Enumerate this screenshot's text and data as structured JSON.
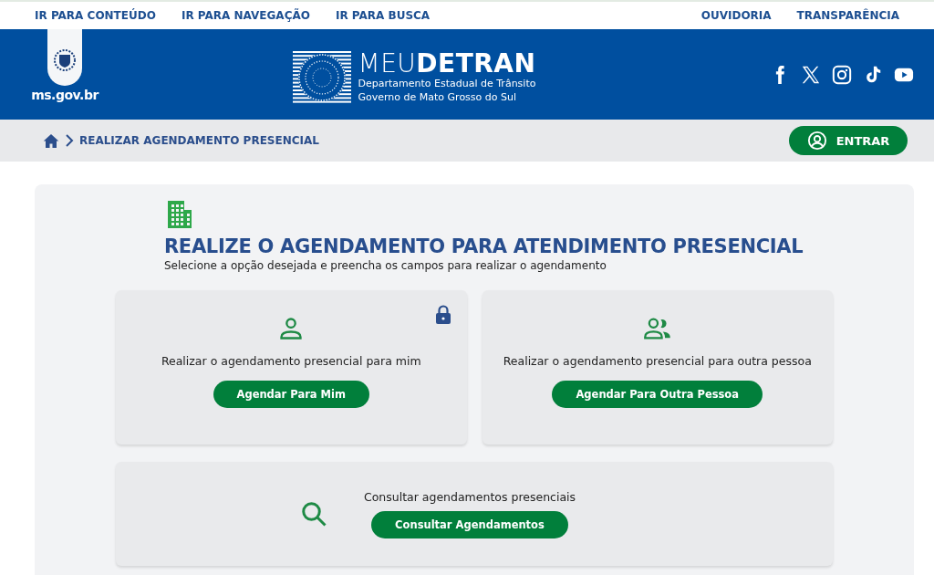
{
  "skip_links": [
    {
      "label": "IR PARA CONTEÚDO"
    },
    {
      "label": "IR PARA NAVEGAÇÃO"
    },
    {
      "label": "IR PARA BUSCA"
    }
  ],
  "top_links": [
    {
      "label": "OUVIDORIA"
    },
    {
      "label": "TRANSPARÊNCIA"
    }
  ],
  "header": {
    "gov_logo": "ms.gov.br",
    "brand": "MEU**DETRAN**",
    "subtitle_lines": [
      "Departamento Estadual de Trânsito",
      "Governo de Mato Grosso do Sul"
    ],
    "social": [
      {
        "kind": "facebook"
      },
      {
        "kind": "x"
      },
      {
        "kind": "instagram"
      },
      {
        "kind": "tiktok"
      },
      {
        "kind": "youtube"
      }
    ]
  },
  "breadcrumb": {
    "current": "REALIZAR AGENDAMENTO PRESENCIAL"
  },
  "login_button": "ENTRAR",
  "main": {
    "title": "REALIZE O AGENDAMENTO PARA ATENDIMENTO PRESENCIAL",
    "subtitle": "Selecione a opção desejada e preencha os campos para realizar o agendamento",
    "options": [
      {
        "kind": "self",
        "text": "Realizar o agendamento presencial para mim",
        "button": "Agendar Para Mim",
        "locked": true
      },
      {
        "kind": "other",
        "text": "Realizar o agendamento presencial para outra pessoa",
        "button": "Agendar Para Outra Pessoa",
        "locked": false
      }
    ],
    "lookup": {
      "text": "Consultar agendamentos presenciais",
      "button": "Consultar Agendamentos"
    }
  }
}
